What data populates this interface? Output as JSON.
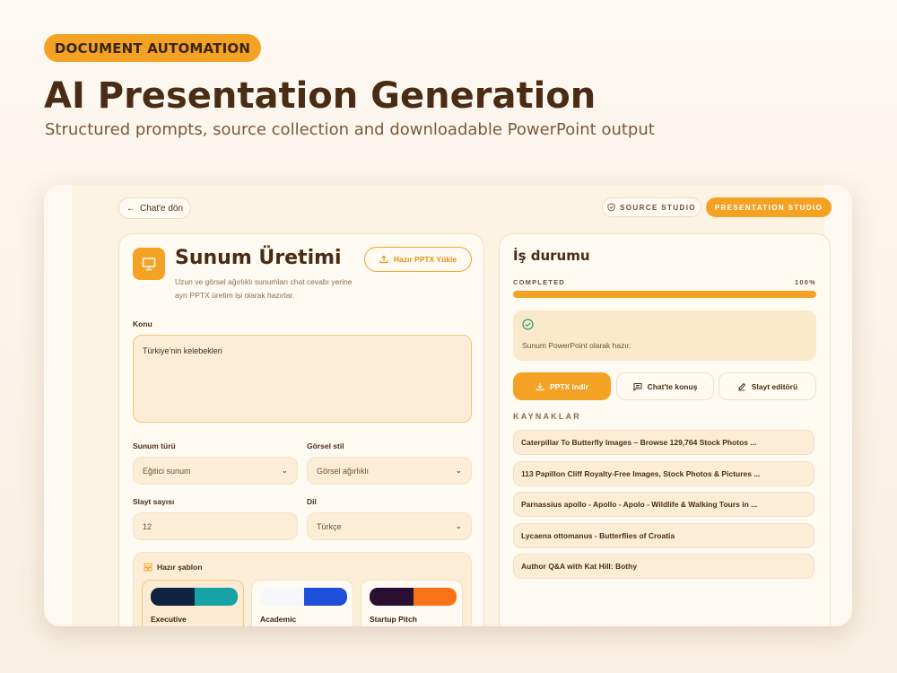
{
  "hero": {
    "badge": "DOCUMENT AUTOMATION",
    "title": "AI Presentation Generation",
    "subtitle": "Structured prompts, source collection and downloadable PowerPoint output"
  },
  "topbar": {
    "back_label": "Chat'e dön",
    "source_studio": "SOURCE STUDIO",
    "presentation_studio": "PRESENTATION STUDIO"
  },
  "form": {
    "title": "Sunum Üretimi",
    "description": "Uzun ve görsel ağırlıklı sunumları chat cevabı yerine ayrı PPTX üretim işi olarak hazırlar.",
    "upload_label": "Hazır PPTX Yükle",
    "topic_label": "Konu",
    "topic_value": "Türkiye'nin kelebekleri",
    "type_label": "Sunum türü",
    "type_value": "Eğitici sunum",
    "style_label": "Görsel stil",
    "style_value": "Görsel ağırlıklı",
    "count_label": "Slayt sayısı",
    "count_value": "12",
    "language_label": "Dil",
    "language_value": "Türkçe",
    "templates_label": "Hazır şablon",
    "templates": [
      {
        "name": "Executive",
        "colors": [
          "#0e2340",
          "#17a2a5"
        ]
      },
      {
        "name": "Academic",
        "colors": [
          "#f5f7fb",
          "#1d4fd8"
        ]
      },
      {
        "name": "Startup Pitch",
        "colors": [
          "#2a0f33",
          "#f97316"
        ]
      }
    ]
  },
  "job": {
    "title": "İş durumu",
    "status": "COMPLETED",
    "percent_label": "100%",
    "progress": 1.0,
    "message": "Sunum PowerPoint olarak hazır.",
    "download_label": "PPTX indir",
    "chat_label": "Chat'te konuş",
    "editor_label": "Slayt editörü",
    "sources_label": "KAYNAKLAR",
    "sources": [
      "Caterpillar To Butterfly Images – Browse 129,764 Stock Photos ...",
      "113 Papillon Cliff Royalty-Free Images, Stock Photos & Pictures ...",
      "Parnassius apollo - Apollo - Apolo - Wildlife & Walking Tours in ...",
      "Lycaena ottomanus - Butterflies of Croatia",
      "Author Q&A with Kat Hill: Bothy"
    ]
  },
  "colors": {
    "accent": "#f4a223",
    "text_dark": "#4a2c15",
    "success": "#22a06b"
  }
}
